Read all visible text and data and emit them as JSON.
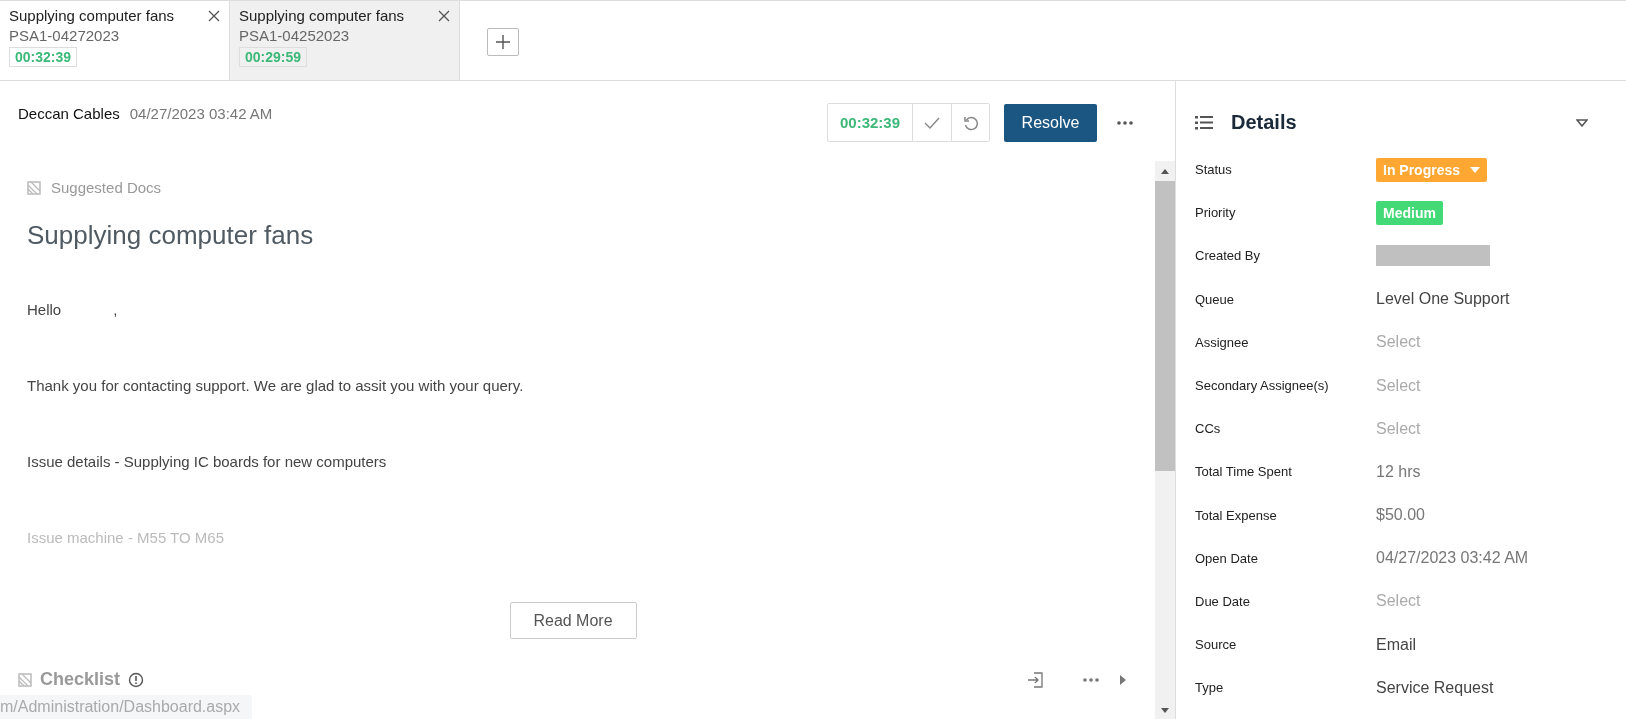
{
  "tabs": [
    {
      "title": "Supplying computer fans",
      "ticket_id": "PSA1-04272023",
      "timer": "00:32:39",
      "selected": true
    },
    {
      "title": "Supplying computer fans",
      "ticket_id": "PSA1-04252023",
      "timer": "00:29:59",
      "selected": false
    }
  ],
  "ticket_header": {
    "customer": "Deccan Cables",
    "date": "04/27/2023 03:42 AM",
    "timer": "00:32:39",
    "resolve_label": "Resolve"
  },
  "suggested_docs": {
    "label": "Suggested Docs"
  },
  "message": {
    "subject": "Supplying computer fans",
    "greeting": "Hello",
    "greeting_end": ",",
    "paragraphs": [
      {
        "text": "Thank you for contacting support. We are glad to assit you with your query.",
        "faded": false
      },
      {
        "text": "Issue details - Supplying IC boards for new computers",
        "faded": false
      },
      {
        "text": "Issue machine - M55 TO M65",
        "faded": true
      }
    ],
    "read_more": "Read More"
  },
  "checklist": {
    "label": "Checklist"
  },
  "status_url": "m/Administration/Dashboard.aspx",
  "details": {
    "title": "Details",
    "fields": [
      {
        "label": "Status",
        "kind": "dropdown-badge",
        "value": "In Progress",
        "color": "#ffa733"
      },
      {
        "label": "Priority",
        "kind": "badge",
        "value": "Medium",
        "color": "#44d977"
      },
      {
        "label": "Created By",
        "kind": "redacted"
      },
      {
        "label": "Queue",
        "kind": "value",
        "value": "Level One Support"
      },
      {
        "label": "Assignee",
        "kind": "select",
        "placeholder": "Select"
      },
      {
        "label": "Secondary Assignee(s)",
        "kind": "select",
        "placeholder": "Select"
      },
      {
        "label": "CCs",
        "kind": "select",
        "placeholder": "Select"
      },
      {
        "label": "Total Time Spent",
        "kind": "muted",
        "value": "12 hrs"
      },
      {
        "label": "Total Expense",
        "kind": "muted",
        "value": "$50.00"
      },
      {
        "label": "Open Date",
        "kind": "muted",
        "value": "04/27/2023 03:42 AM"
      },
      {
        "label": "Due Date",
        "kind": "select",
        "placeholder": "Select"
      },
      {
        "label": "Source",
        "kind": "value",
        "value": "Email"
      },
      {
        "label": "Type",
        "kind": "value",
        "value": "Service Request"
      }
    ]
  }
}
